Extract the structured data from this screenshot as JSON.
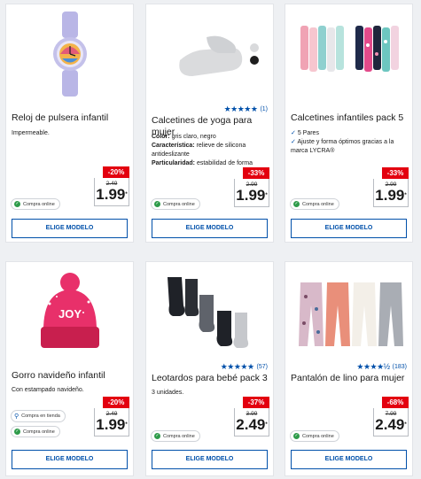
{
  "products": [
    {
      "title": "Reloj de pulsera infantil",
      "desc": "Impermeable.",
      "discount": "-20%",
      "old_price": "2.49",
      "new_price": "1.99",
      "badges": [
        "Compra online"
      ],
      "button": "ELIGE MODELO",
      "image": "watch-image"
    },
    {
      "title": "Calcetines de yoga para mujer",
      "rating_count": "(1)",
      "rating_value": 5,
      "desc_rows": [
        {
          "label": "Color:",
          "value": "gris claro, negro"
        },
        {
          "label": "Característica:",
          "value": "relieve de silicona antideslizante"
        },
        {
          "label": "Particularidad:",
          "value": "estabilidad de forma"
        }
      ],
      "discount": "-33%",
      "old_price": "2.99",
      "new_price": "1.99",
      "badges": [
        "Compra online"
      ],
      "button": "ELIGE MODELO",
      "color_swatches": [
        "#d9dadc",
        "#1e1e1e"
      ],
      "image": "socks-image"
    },
    {
      "title": "Calcetines infantiles pack 5",
      "bullets": [
        "5 Pares",
        "Ajuste y forma óptimos gracias a la marca LYCRA®"
      ],
      "discount": "-33%",
      "old_price": "2.99",
      "new_price": "1.99",
      "badges": [
        "Compra online"
      ],
      "button": "ELIGE MODELO",
      "image": "kids-socks-image"
    },
    {
      "title": "Gorro navideño infantil",
      "desc": "Con estampado navideño.",
      "discount": "-20%",
      "old_price": "2.49",
      "new_price": "1.99",
      "badges": [
        "Compra en tienda",
        "Compra online"
      ],
      "button": "ELIGE MODELO",
      "image": "beanie-image"
    },
    {
      "title": "Leotardos para bebé pack 3",
      "rating_count": "(57)",
      "rating_value": 5,
      "desc": "3 unidades.",
      "discount": "-37%",
      "old_price": "3.99",
      "new_price": "2.49",
      "badges": [
        "Compra online"
      ],
      "button": "ELIGE MODELO",
      "image": "tights-image"
    },
    {
      "title": "Pantalón de lino para mujer",
      "rating_count": "(183)",
      "rating_value": 4.5,
      "discount": "-68%",
      "old_price": "7.99",
      "new_price": "2.49",
      "badges": [
        "Compra online"
      ],
      "button": "ELIGE MODELO",
      "image": "pants-image"
    }
  ],
  "colors": {
    "accent_blue": "#0050aa",
    "discount_red": "#e3000f",
    "online_green": "#2e9b4a"
  }
}
